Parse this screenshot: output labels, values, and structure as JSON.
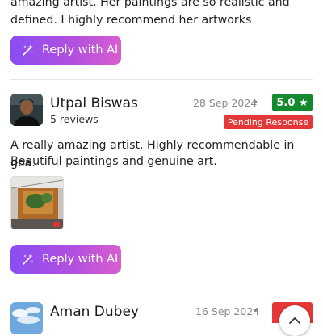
{
  "previous_review": {
    "body_line1": "amazing artist. Her paintings are so realistic and",
    "body_line2": "defined. I highly recommend her artworks",
    "ai_button_label": "Reply with AI"
  },
  "review1": {
    "name": "Utpal Biswas",
    "reviews_count": "5 reviews",
    "date": "28 Sep 2024",
    "separator": "•",
    "rating": "5.0 ★",
    "status": "Pending Response",
    "body_line1": "A really amazing artist. Highly recommendable in goa.",
    "body_line2": "Beautiful paintings and genuine art.",
    "ai_button_label": "Reply with AI"
  },
  "review2": {
    "name": "Aman Dubey",
    "date": "16 Sep 2024",
    "separator": "•"
  },
  "icons": {
    "ai_button_icon": "magic-wand-icon",
    "scroll_up_icon": "chevron-up-icon"
  },
  "colors": {
    "ai_button_gradient_start": "#8a4df3",
    "ai_button_gradient_end": "#d85fcf",
    "rating_badge": "#138a2e",
    "pending_badge": "#e43838"
  }
}
